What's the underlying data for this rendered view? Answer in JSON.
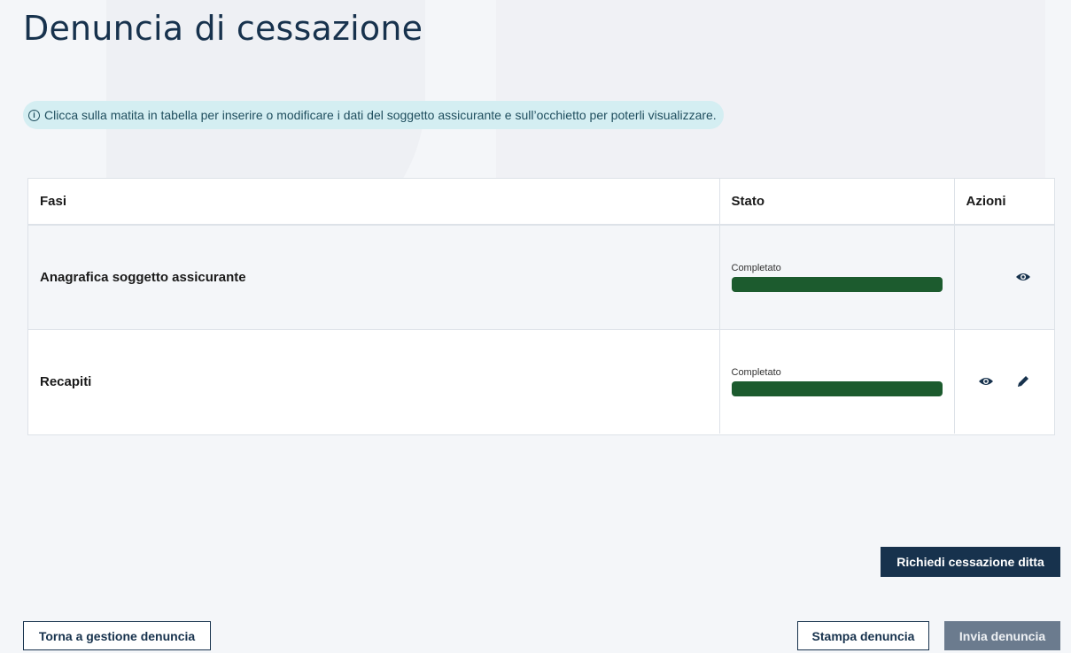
{
  "page": {
    "title": "Denuncia di cessazione"
  },
  "info": {
    "icon": "info-circle-icon",
    "text": "Clicca sulla matita in tabella per inserire o modificare i dati del soggetto assicurante e sull’occhietto per poterli visualizzare."
  },
  "table": {
    "headers": {
      "fasi": "Fasi",
      "stato": "Stato",
      "azioni": "Azioni"
    },
    "rows": [
      {
        "fase": "Anagrafica soggetto assicurante",
        "stato_label": "Completato",
        "progress_percent": 100,
        "actions": [
          "eye-icon"
        ]
      },
      {
        "fase": "Recapiti",
        "stato_label": "Completato",
        "progress_percent": 100,
        "actions": [
          "eye-icon",
          "pencil-icon"
        ]
      }
    ]
  },
  "buttons": {
    "richiedi_cessazione": "Richiedi cessazione ditta",
    "torna": "Torna a gestione denuncia",
    "stampa": "Stampa denuncia",
    "invia": "Invia denuncia"
  },
  "colors": {
    "primary": "#17324d",
    "progress": "#1c5b2e",
    "info_bg": "#d4eef2",
    "disabled": "#6b7b8e"
  }
}
